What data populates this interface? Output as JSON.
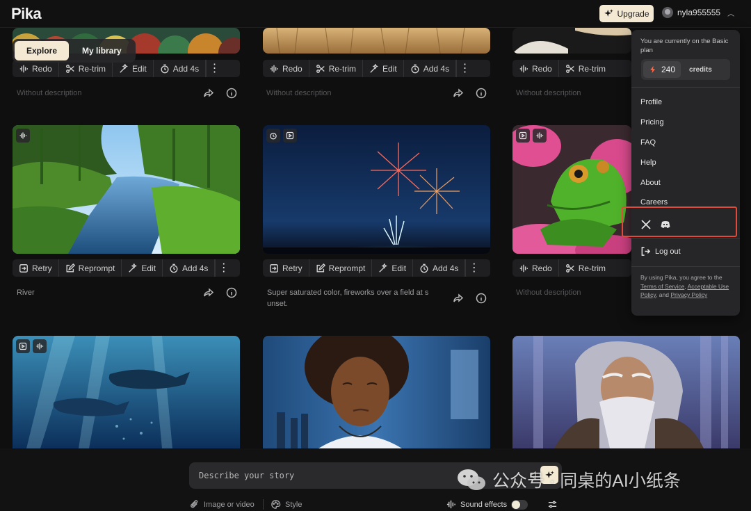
{
  "app": {
    "logo": "Pika"
  },
  "header": {
    "upgrade_label": "Upgrade",
    "username": "nyla955555"
  },
  "tabs": [
    {
      "label": "Explore",
      "active": true
    },
    {
      "label": "My library",
      "active": false
    }
  ],
  "cards": [
    {
      "toolbar": [
        "Redo",
        "Re-trim",
        "Edit",
        "Add 4s"
      ],
      "description": "Without description",
      "has_description": false,
      "badges": []
    },
    {
      "toolbar": [
        "Redo",
        "Re-trim",
        "Edit",
        "Add 4s"
      ],
      "description": "Without description",
      "has_description": false,
      "badges": []
    },
    {
      "toolbar": [
        "Redo",
        "Re-trim"
      ],
      "description": "Without description",
      "has_description": false,
      "badges": []
    },
    {
      "toolbar": [
        "Retry",
        "Reprompt",
        "Edit",
        "Add 4s"
      ],
      "description": "River",
      "has_description": true,
      "badges": [
        "sound-wave-icon"
      ]
    },
    {
      "toolbar": [
        "Retry",
        "Reprompt",
        "Edit",
        "Add 4s"
      ],
      "description": "Super saturated color, fireworks over a field at s unset.",
      "has_description": true,
      "badges": [
        "timer-icon",
        "play-icon"
      ]
    },
    {
      "toolbar": [
        "Redo",
        "Re-trim"
      ],
      "description": "Without description",
      "has_description": false,
      "badges": [
        "play-icon",
        "sound-wave-icon"
      ]
    },
    {
      "toolbar": [],
      "description": "",
      "badges": [
        "play-icon",
        "sound-wave-icon"
      ]
    },
    {
      "toolbar": [],
      "description": "",
      "badges": []
    },
    {
      "toolbar": [],
      "description": "",
      "badges": []
    }
  ],
  "dropdown": {
    "plan_text": "You are currently on the Basic plan",
    "credits_value": "240",
    "credits_label": "credits",
    "menu": [
      "Profile",
      "Pricing",
      "FAQ",
      "Help",
      "About",
      "Careers"
    ],
    "logout_label": "Log out",
    "legal_prefix": "By using Pika, you agree to the",
    "legal_tos": "Terms of Service",
    "legal_aup": "Acceptable Use Policy",
    "legal_and": ", and",
    "legal_privacy": "Privacy Policy"
  },
  "composer": {
    "placeholder": "Describe your story",
    "image_or_video": "Image or video",
    "style": "Style",
    "sound_effects": "Sound effects"
  },
  "watermark": {
    "text": "公众号 · 同桌的AI小纸条"
  },
  "colors": {
    "accent": "#f4ead4",
    "background": "#0f0f10",
    "highlight_box": "#e04a3a"
  }
}
